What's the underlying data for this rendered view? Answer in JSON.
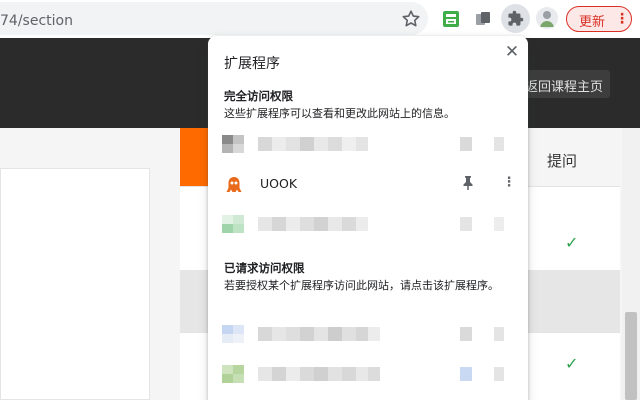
{
  "browser": {
    "url_text": "74/section",
    "update_label": "更新",
    "update_menu_glyph": "⋮",
    "star_icon": "star-icon",
    "puzzle_icon": "extensions-puzzle-icon"
  },
  "page": {
    "back_label": "返回课程主页",
    "column_header": "提问",
    "check_glyph": "✓",
    "accent_color": "#ff6a00"
  },
  "popup": {
    "title": "扩展程序",
    "close_glyph": "✕",
    "full_access": {
      "title": "完全访问权限",
      "description": "这些扩展程序可以查看和更改此网站上的信息。"
    },
    "requested_access": {
      "title": "已请求访问权限",
      "description": "若要授权某个扩展程序访问此网站，请点击该扩展程序。"
    },
    "visible_extension": {
      "name": "UOOK",
      "more_glyph": "⋮"
    }
  }
}
